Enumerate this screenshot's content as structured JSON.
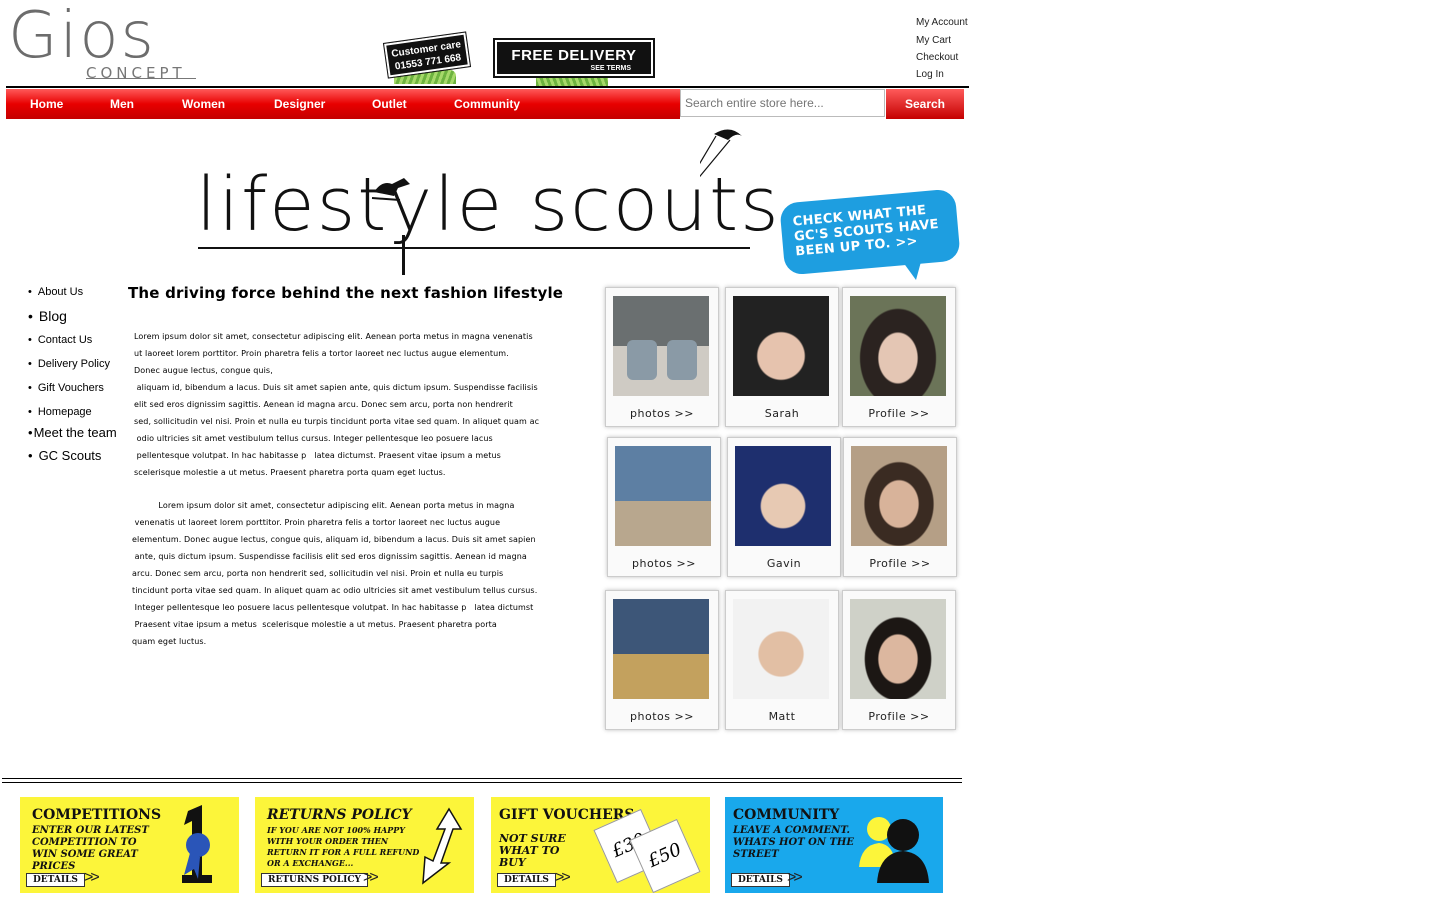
{
  "header": {
    "logo_main": "Gios",
    "logo_sub": "CONCEPT",
    "customer_care_label": "Customer care",
    "customer_care_phone": "01553 771 668",
    "free_delivery_label": "FREE DELIVERY",
    "free_delivery_sub": "SEE TERMS",
    "account_links": [
      "My Account",
      "My Cart",
      "Checkout",
      "Log In"
    ]
  },
  "nav": {
    "items": [
      "Home",
      "Men",
      "Women",
      "Designer",
      "Outlet",
      "Community"
    ],
    "search_placeholder": "Search entire store here...",
    "search_button": "Search"
  },
  "hero": {
    "title": "lifestyle scouts",
    "bubble_text": "CHECK WHAT THE GC'S SCOUTS HAVE BEEN UP TO. >>"
  },
  "sidebar": {
    "items": [
      "About Us",
      "Blog",
      "Contact Us",
      "Delivery Policy",
      "Gift Vouchers",
      "Homepage",
      "Meet the team",
      "GC Scouts"
    ]
  },
  "main": {
    "tagline": "The driving force behind the next fashion lifestyle",
    "para1": [
      "Lorem ipsum dolor sit amet, consectetur adipiscing elit. Aenean porta metus in magna venenatis",
      "ut laoreet lorem porttitor. Proin pharetra felis a tortor laoreet nec luctus augue elementum.",
      "Donec augue lectus, congue quis,",
      " aliquam id, bibendum a lacus. Duis sit amet sapien ante, quis dictum ipsum. Suspendisse facilisis",
      "elit sed eros dignissim sagittis. Aenean id magna arcu. Donec sem arcu, porta non hendrerit",
      "sed, sollicitudin vel nisi. Proin et nulla eu  turpis tincidunt porta vitae sed quam. In aliquet quam ac",
      " odio ultricies sit amet vestibulum tellus cursus. Integer pellentesque leo posuere lacus",
      " pellentesque volutpat. In hac habitasse p   latea dictumst. Praesent vitae ipsum a metus",
      "scelerisque molestie a ut metus. Praesent pharetra porta quam eget luctus."
    ],
    "para2": [
      "          Lorem ipsum dolor sit amet, consectetur adipiscing elit. Aenean porta metus in magna",
      " venenatis ut laoreet lorem porttitor. Proin pharetra felis a tortor laoreet nec luctus augue",
      "elementum. Donec augue lectus, congue quis, aliquam id, bibendum a lacus. Duis sit amet sapien",
      " ante, quis dictum ipsum. Suspendisse facilisis elit sed eros dignissim sagittis. Aenean id magna",
      "arcu. Donec sem arcu, porta non hendrerit sed, sollicitudin vel nisi. Proin et nulla eu  turpis",
      "tincidunt porta vitae sed quam. In aliquet quam ac odio ultricies sit amet vestibulum tellus cursus.",
      " Integer pellentesque leo posuere lacus pellentesque volutpat. In hac habitasse p   latea dictumst",
      " Praesent vitae ipsum a metus  scelerisque molestie a ut metus. Praesent pharetra porta",
      "quam eget luctus."
    ]
  },
  "scouts": {
    "rows": [
      {
        "photos": "photos >>",
        "name": "Sarah",
        "profile": "Profile >>"
      },
      {
        "photos": "photos >>",
        "name": "Gavin",
        "profile": "Profile >>"
      },
      {
        "photos": "photos >>",
        "name": "Matt",
        "profile": "Profile >>"
      }
    ]
  },
  "promos": [
    {
      "title": "COMPETITIONS",
      "desc": "Enter our latest competition to win some great prices",
      "button": "DETAILS",
      "bg": "#fcf53a"
    },
    {
      "title": "RETURNS POLICY",
      "desc": "If you are not 100% happy with your order then return it for a full refund or a exchange...",
      "button": "RETURNS POLICY",
      "bg": "#fcf53a"
    },
    {
      "title": "GIFT VOUCHERS",
      "desc": "Not sure what to buy",
      "button": "DETAILS",
      "bg": "#fcf53a",
      "voucher1": "£30",
      "voucher2": "£50"
    },
    {
      "title": "COMMUNITY",
      "desc": "Leave a comment. Whats hot on the street",
      "button": "DETAILS",
      "bg": "#19a8ec"
    }
  ],
  "colors": {
    "nav_red": "#e80000",
    "bubble_blue": "#1e9ee0",
    "promo_yellow": "#fcf53a",
    "community_blue": "#19a8ec"
  }
}
